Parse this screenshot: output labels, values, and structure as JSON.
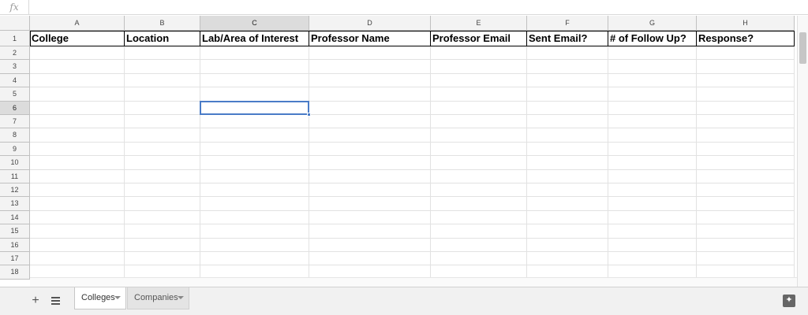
{
  "formula_bar": {
    "fx_label": "fx",
    "value": ""
  },
  "columns": [
    "A",
    "B",
    "C",
    "D",
    "E",
    "F",
    "G",
    "H"
  ],
  "rows": [
    "1",
    "2",
    "3",
    "4",
    "5",
    "6",
    "7",
    "8",
    "9",
    "10",
    "11",
    "12",
    "13",
    "14",
    "15",
    "16",
    "17",
    "18"
  ],
  "header_row": [
    "College",
    "Location",
    "Lab/Area of Interest",
    "Professor Name",
    "Professor Email",
    "Sent Email?",
    "# of Follow Up?",
    "Response?"
  ],
  "selected_cell": {
    "column": "C",
    "row": "6"
  },
  "sheet_tabs": [
    {
      "label": "Colleges",
      "active": true
    },
    {
      "label": "Companies",
      "active": false
    }
  ],
  "colors": {
    "selection": "#4a7cc7",
    "header_background": "#f3f3f3",
    "selected_header_background": "#dcdcdc"
  },
  "icons": {
    "add_sheet": "plus-icon",
    "all_sheets": "menu-lines-icon",
    "explore": "explore-star-icon"
  }
}
